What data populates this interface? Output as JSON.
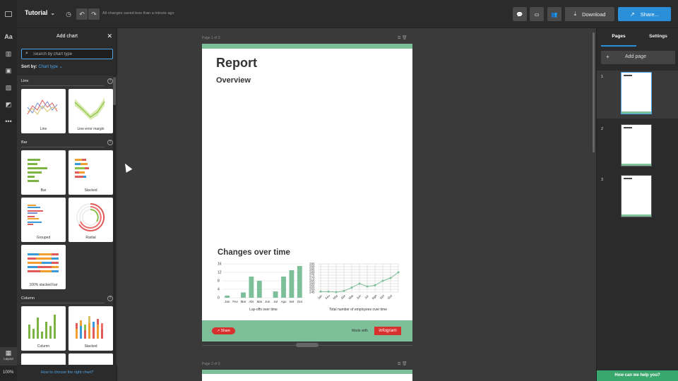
{
  "app": {
    "project_title": "Tutorial",
    "save_status": "All changes saved less than a minute ago",
    "download_label": "Download",
    "share_label": "Share...",
    "zoom": "100%",
    "layout_label": "Layout"
  },
  "panel": {
    "title": "Add chart",
    "search_placeholder": "Search by chart type",
    "sort_label": "Sort by:",
    "sort_value": "Chart type",
    "sections": [
      {
        "label": "Line",
        "cards": [
          "Line",
          "Line error margin"
        ]
      },
      {
        "label": "Bar",
        "cards": [
          "Bar",
          "Stacked",
          "Grouped",
          "Radial",
          "100% stacked bar"
        ]
      },
      {
        "label": "Column",
        "cards": [
          "Column",
          "Stacked"
        ]
      }
    ],
    "help_link": "How to choose the right chart?"
  },
  "canvas": {
    "page1_label": "Page 1 of 3",
    "page2_label": "Page 2 of 3",
    "report_title": "Report",
    "report_subtitle": "Overview",
    "changes_title": "Changes over time",
    "share_pill": "Share",
    "made_with": "Made with",
    "brand": "infogram"
  },
  "chart_data": [
    {
      "type": "bar",
      "categories": [
        "Jan",
        "Fev",
        "Mar",
        "Abr",
        "Mai",
        "Jun",
        "Jul",
        "Ago",
        "Set",
        "Out"
      ],
      "values": [
        1,
        0,
        2.5,
        10,
        8,
        0,
        3,
        10,
        13,
        15
      ],
      "xlabel": "Lay-offs over time",
      "yticks": [
        0,
        4,
        8,
        12,
        16
      ],
      "ylim": [
        0,
        16
      ],
      "color": "#7cbf99"
    },
    {
      "type": "line",
      "categories": [
        "Jan",
        "Fev",
        "Mar",
        "Abr",
        "Mai",
        "Jun",
        "Jul",
        "Ago",
        "Set",
        "Out"
      ],
      "values": [
        246,
        246,
        245,
        247,
        253,
        260,
        255,
        257,
        265,
        270,
        280
      ],
      "xlabel": "Total number of employees over time",
      "yticks": [
        245,
        250,
        255,
        260,
        265,
        270,
        275,
        280,
        285,
        290,
        295
      ],
      "ylim": [
        245,
        295
      ],
      "color": "#7cbf99"
    }
  ],
  "right": {
    "tab_pages": "Pages",
    "tab_settings": "Settings",
    "add_page": "Add page",
    "pages": [
      "1",
      "2",
      "3"
    ],
    "help_button": "How can we help you?"
  }
}
